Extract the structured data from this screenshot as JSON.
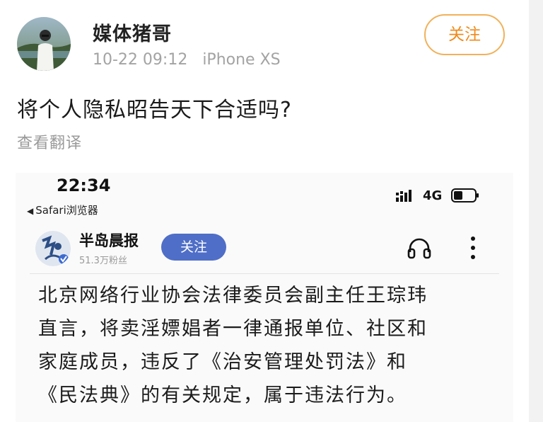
{
  "post": {
    "author": "媒体猪哥",
    "time": "10-22 09:12",
    "device": "iPhone XS",
    "follow_label": "关注",
    "text": "将个人隐私昭告天下合适吗?",
    "translate_label": "查看翻译"
  },
  "screenshot": {
    "status_time": "22:34",
    "back_app": "Safari浏览器",
    "network": "4G",
    "source_name": "半岛晨报",
    "source_fans": "51.3万粉丝",
    "follow_label": "关注",
    "article_lines": [
      "北京网络行业协会法律委员会副主任王琮玮",
      "直言，将卖淫嫖娼者一律通报单位、社区和",
      "家庭成员，违反了《治安管理处罚法》和",
      "《民法典》的有关规定，属于违法行为。"
    ]
  },
  "colors": {
    "follow_orange": "#f08a1a",
    "follow_blue": "#4f6ec7",
    "meta_gray": "#a3a3a3"
  },
  "icons": [
    "avatar",
    "back-arrow-icon",
    "signal-icon",
    "battery-icon",
    "headphones-icon",
    "more-vertical-icon"
  ]
}
